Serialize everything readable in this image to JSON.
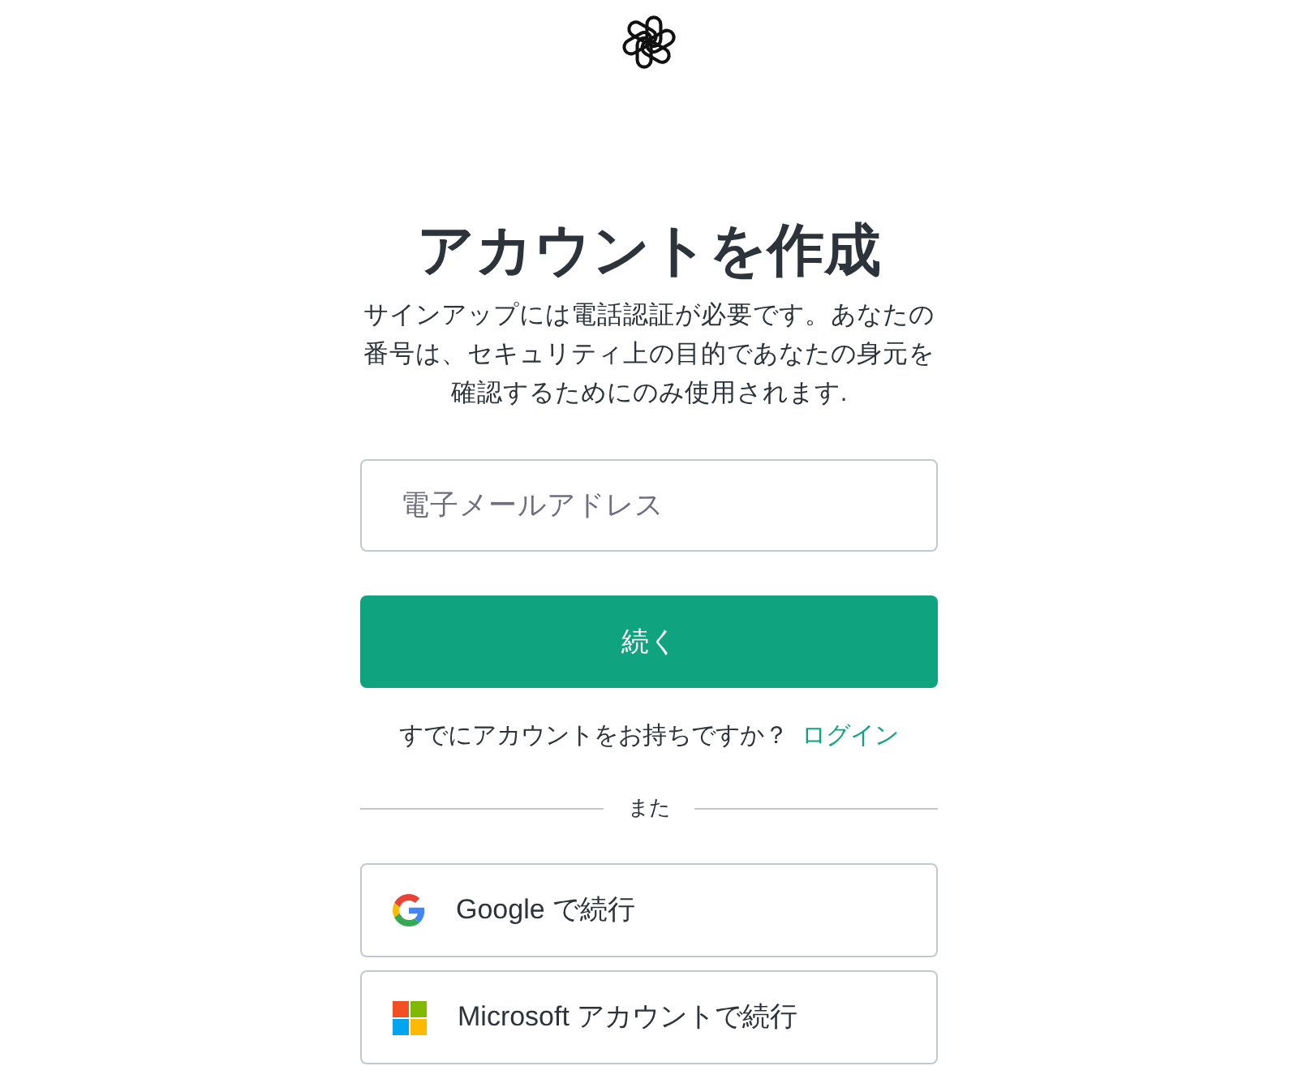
{
  "heading": "アカウントを作成",
  "description": "サインアップには電話認証が必要です。あなたの番号は、セキュリティ上の目的であなたの身元を確認するためにのみ使用されます.",
  "email_field": {
    "placeholder": "電子メールアドレス"
  },
  "continue_button": "続く",
  "login_prompt": {
    "text": "すでにアカウントをお持ちですか？",
    "link": "ログイン"
  },
  "divider": "また",
  "social_buttons": [
    {
      "kind": "google",
      "label": "Google で続行"
    },
    {
      "kind": "microsoft",
      "label": "Microsoft アカウントで続行"
    }
  ]
}
